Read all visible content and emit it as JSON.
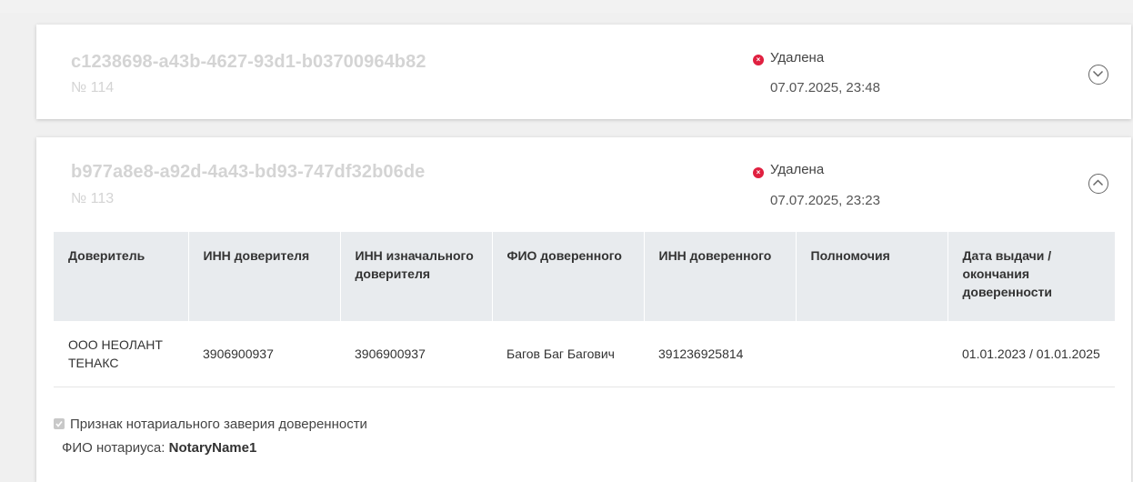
{
  "cards": [
    {
      "id": "c1238698-a43b-4627-93d1-b03700964b82",
      "number": "№ 114",
      "status": "Удалена",
      "date": "07.07.2025, 23:48",
      "toggle_icon": "chevron-down-circle-icon"
    },
    {
      "id": "b977a8e8-a92d-4a43-bd93-747df32b06de",
      "number": "№ 113",
      "status": "Удалена",
      "date": "07.07.2025, 23:23",
      "toggle_icon": "chevron-up-circle-icon"
    }
  ],
  "table": {
    "headers": [
      "Доверитель",
      "ИНН доверителя",
      "ИНН изначального доверителя",
      "ФИО доверенного",
      "ИНН доверенного",
      "Полномочия",
      "Дата выдачи / окончания доверенности"
    ],
    "rows": [
      {
        "principal": "ООО НЕОЛАНТ ТЕНАКС",
        "principal_inn": "3906900937",
        "original_principal_inn": "3906900937",
        "attorney_name": "Багов Баг Багович",
        "attorney_inn": "391236925814",
        "powers": "",
        "dates": "01.01.2023 / 01.01.2025"
      }
    ]
  },
  "notary": {
    "checkbox_label": "Признак нотариального заверия доверенности",
    "checked": true,
    "name_label": "ФИО нотариуса:",
    "name_value": "NotaryName1"
  },
  "colors": {
    "status_deleted": "#e02040",
    "header_bg": "#e8ebee",
    "muted_title": "#d4d4d4"
  }
}
